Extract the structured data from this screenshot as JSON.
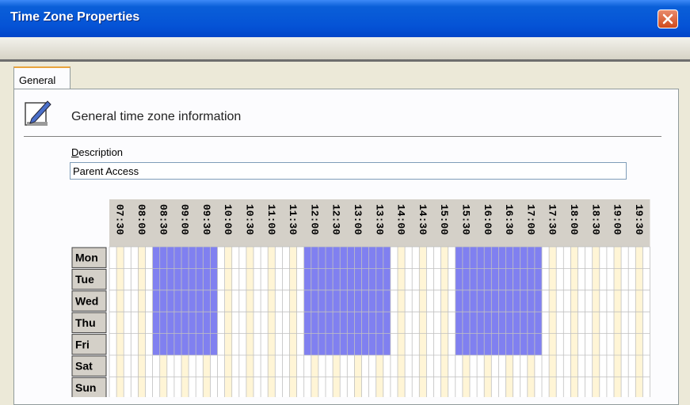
{
  "window": {
    "title": "Time Zone Properties"
  },
  "tabs": [
    {
      "label": "General",
      "active": true
    }
  ],
  "section": {
    "heading": "General time zone information"
  },
  "description": {
    "label": "Description",
    "value": "Parent Access"
  },
  "schedule": {
    "time_columns": [
      "07:30",
      "08:00",
      "08:30",
      "09:00",
      "09:30",
      "10:00",
      "10:30",
      "11:00",
      "11:30",
      "12:00",
      "12:30",
      "13:00",
      "13:30",
      "14:00",
      "14:30",
      "15:00",
      "15:30",
      "16:00",
      "16:30",
      "17:00",
      "17:30",
      "18:00",
      "18:30",
      "19:00",
      "19:30"
    ],
    "days": [
      "Mon",
      "Tue",
      "Wed",
      "Thu",
      "Fri",
      "Sat",
      "Sun"
    ],
    "selected_ranges": [
      {
        "days": [
          "Mon",
          "Tue",
          "Wed",
          "Thu",
          "Fri"
        ],
        "start": "08:30",
        "end": "10:00"
      },
      {
        "days": [
          "Mon",
          "Tue",
          "Wed",
          "Thu",
          "Fri"
        ],
        "start": "12:00",
        "end": "14:00"
      },
      {
        "days": [
          "Mon",
          "Tue",
          "Wed",
          "Thu",
          "Fri"
        ],
        "start": "15:30",
        "end": "17:30"
      }
    ],
    "colors": {
      "selected": "#8080f0",
      "highlight_column": "#fff5d6",
      "header_bg": "#d4d0c8",
      "grid_line": "#c0c0c0"
    }
  }
}
